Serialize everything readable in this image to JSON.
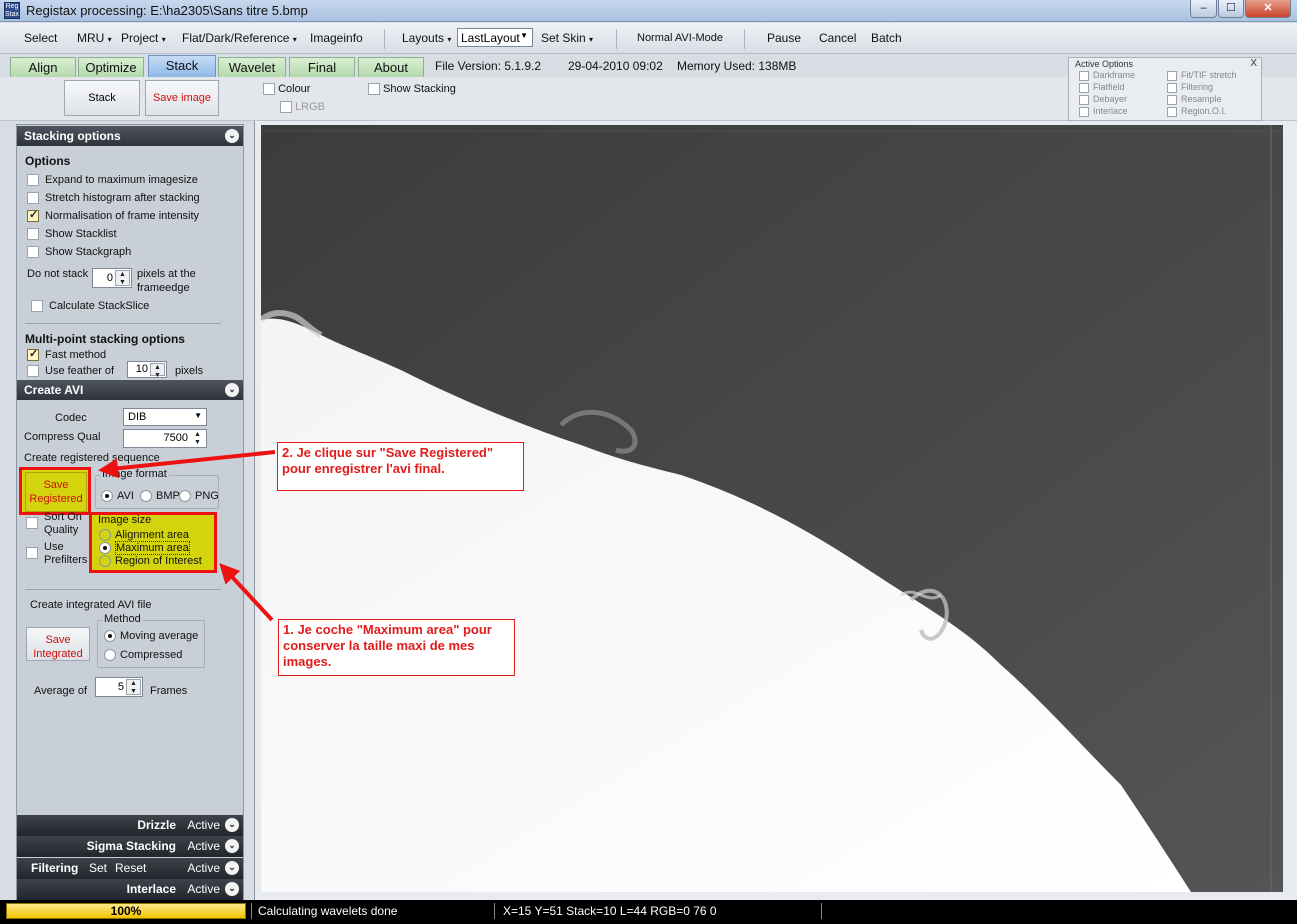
{
  "window": {
    "title": "Registax processing: E:\\ha2305\\Sans titre 5.bmp",
    "app_icon_text": "Reg Stax"
  },
  "menubar": {
    "select": "Select",
    "mru": "MRU",
    "project": "Project",
    "flat": "Flat/Dark/Reference",
    "imageinfo": "Imageinfo",
    "layouts": "Layouts",
    "layout_value": "LastLayout",
    "set_skin": "Set Skin",
    "normal_avi": "Normal AVI-Mode",
    "pause": "Pause",
    "cancel": "Cancel",
    "batch": "Batch"
  },
  "tabs": {
    "align": "Align",
    "optimize": "Optimize",
    "stack": "Stack",
    "wavelet": "Wavelet",
    "final": "Final",
    "about": "About"
  },
  "tabinfo": {
    "version": "File Version: 5.1.9.2",
    "date": "29-04-2010 09:02",
    "memory": "Memory Used: 138MB"
  },
  "toolbar": {
    "stack": "Stack",
    "save_image": "Save image",
    "colour": "Colour",
    "lrgb": "LRGB",
    "show_stacking": "Show Stacking"
  },
  "active_options": {
    "header": "Active Options",
    "close": "X",
    "left": [
      "Darkframe",
      "Flatfield",
      "Debayer",
      "Interlace"
    ],
    "right": [
      "Fit/TIF stretch",
      "Filtering",
      "Resample",
      "Region.O.I."
    ]
  },
  "stacking": {
    "header": "Stacking options",
    "options_title": "Options",
    "expand": "Expand to maximum imagesize",
    "stretch": "Stretch histogram after stacking",
    "normalisation": "Normalisation of frame intensity",
    "show_stacklist": "Show Stacklist",
    "show_stackgraph": "Show Stackgraph",
    "do_not_stack": "Do not stack",
    "do_not_stack_value": "0",
    "pixels_at_frameedge": "pixels at the frameedge",
    "calc_stackslice": "Calculate StackSlice",
    "multipoint_title": "Multi-point stacking options",
    "fast_method": "Fast method",
    "use_feather": "Use feather of",
    "feather_value": "10",
    "pixels": "pixels"
  },
  "create_avi": {
    "header": "Create AVI",
    "codec_label": "Codec",
    "codec_value": "DIB",
    "compress_label": "Compress Qual",
    "compress_value": "7500",
    "create_registered": "Create registered sequence",
    "save_registered": "Save Registered",
    "image_format": "Image format",
    "avi": "AVI",
    "bmp": "BMP",
    "png": "PNG",
    "sort_on_quality": "Sort On Quality",
    "use_prefilters": "Use Prefilters",
    "image_size": "Image size",
    "alignment_area": "Alignment area",
    "maximum_area": "Maximum area",
    "region_of_interest": "Region of Interest",
    "create_integrated": "Create integrated AVI file",
    "save_integrated": "Save Integrated",
    "method": "Method",
    "moving_average": "Moving average",
    "compressed": "Compressed",
    "average_of": "Average of",
    "average_value": "5",
    "frames": "Frames"
  },
  "bottom_sections": {
    "drizzle": "Drizzle",
    "sigma": "Sigma Stacking",
    "filtering": "Filtering",
    "set": "Set",
    "reset": "Reset",
    "interlace": "Interlace",
    "active": "Active"
  },
  "annotations": {
    "note2": "2. Je clique sur \"Save Registered\" pour enregistrer l'avi final.",
    "note1": "1. Je coche \"Maximum area\" pour conserver la taille maxi de mes images."
  },
  "status": {
    "progress": "100%",
    "progress_value": 1.0,
    "message": "Calculating wavelets done",
    "coords": "X=15 Y=51 Stack=10 L=44 RGB=0 76 0"
  },
  "colors": {
    "annotation_red": "#e21b1b",
    "highlight_yellow": "#d4d40e",
    "progress_yellow": "#f3c400"
  }
}
